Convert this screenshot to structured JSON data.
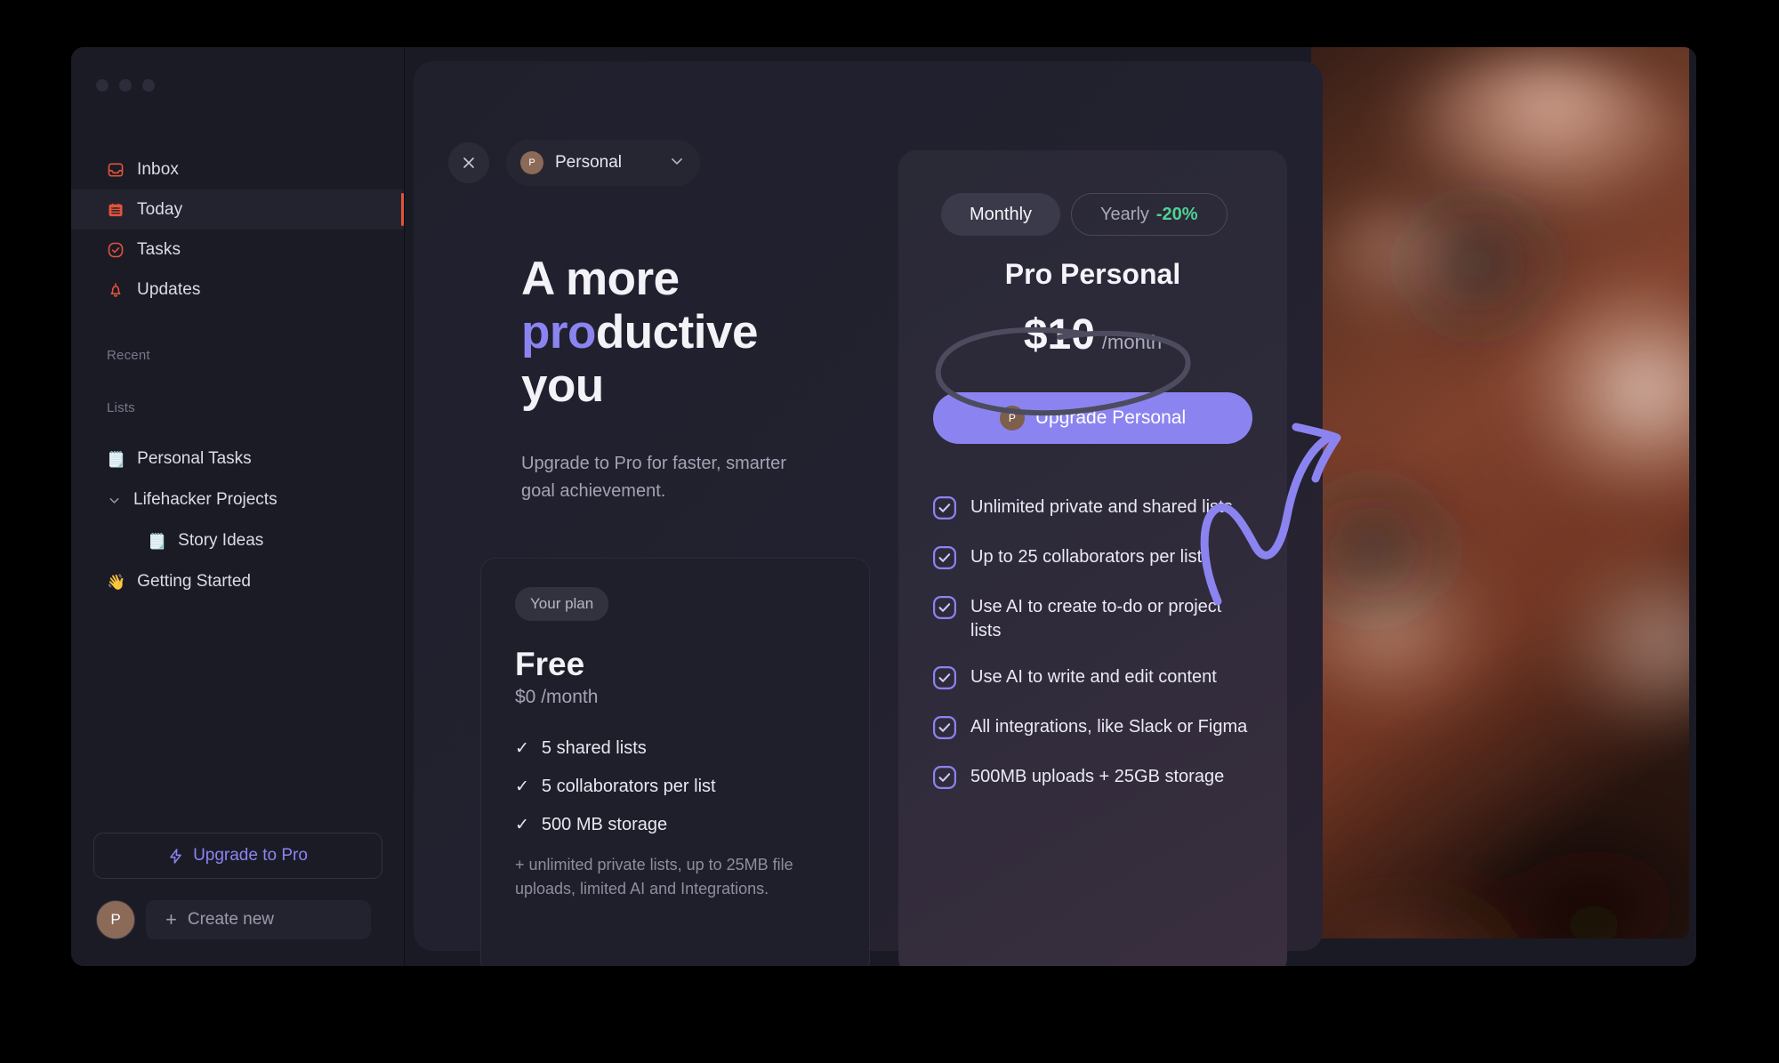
{
  "window": {
    "traffic_lights": [
      "close",
      "minimize",
      "maximize"
    ]
  },
  "sidebar": {
    "nav": [
      {
        "label": "Inbox",
        "icon": "inbox-icon",
        "active": false
      },
      {
        "label": "Today",
        "icon": "calendar-icon",
        "active": true
      },
      {
        "label": "Tasks",
        "icon": "check-circle-icon",
        "active": false
      },
      {
        "label": "Updates",
        "icon": "bell-icon",
        "active": false
      }
    ],
    "section_recent": "Recent",
    "section_lists": "Lists",
    "lists": [
      {
        "label": "Personal Tasks",
        "emoji": "🗒️",
        "child": false,
        "chevron": false
      },
      {
        "label": "Lifehacker Projects",
        "emoji": "",
        "child": false,
        "chevron": true
      },
      {
        "label": "Story Ideas",
        "emoji": "🗒️",
        "child": true,
        "chevron": false
      },
      {
        "label": "Getting Started",
        "emoji": "👋",
        "child": false,
        "chevron": false
      }
    ],
    "upgrade_button": "Upgrade to Pro",
    "avatar_initial": "P",
    "create_new": "Create new"
  },
  "modal": {
    "close_label": "×",
    "org": {
      "initial": "P",
      "name": "Personal"
    },
    "headline": {
      "line1": "A more",
      "highlight": "pro",
      "line2_rest": "ductive",
      "line3": "you"
    },
    "subtitle": "Upgrade to Pro for faster, smarter goal achievement.",
    "free_plan": {
      "badge": "Your plan",
      "title": "Free",
      "price": "$0 /month",
      "features": [
        "5 shared lists",
        "5 collaborators per list",
        "500 MB storage"
      ],
      "note": "+ unlimited private lists, up to 25MB file uploads, limited AI and Integrations."
    },
    "pro_plan": {
      "billing": {
        "monthly": "Monthly",
        "yearly": "Yearly",
        "yearly_discount": "-20%",
        "selected": "Monthly"
      },
      "title": "Pro Personal",
      "amount": "$10",
      "period": "/month",
      "cta_initial": "P",
      "cta_label": "Upgrade Personal",
      "features": [
        "Unlimited private and shared lists",
        "Up to 25 collaborators per list",
        "Use AI to create to-do or project lists",
        "Use AI to write and edit content",
        "All integrations, like Slack or Figma",
        "500MB uploads + 25GB storage"
      ]
    }
  },
  "colors": {
    "accent_purple": "#8b84f0",
    "accent_green": "#4fd295",
    "accent_red": "#e2543a",
    "avatar_brown": "#8b6a57",
    "window_bg": "#161620",
    "sidebar_bg": "#1b1b26",
    "modal_bg": "#20202d"
  }
}
